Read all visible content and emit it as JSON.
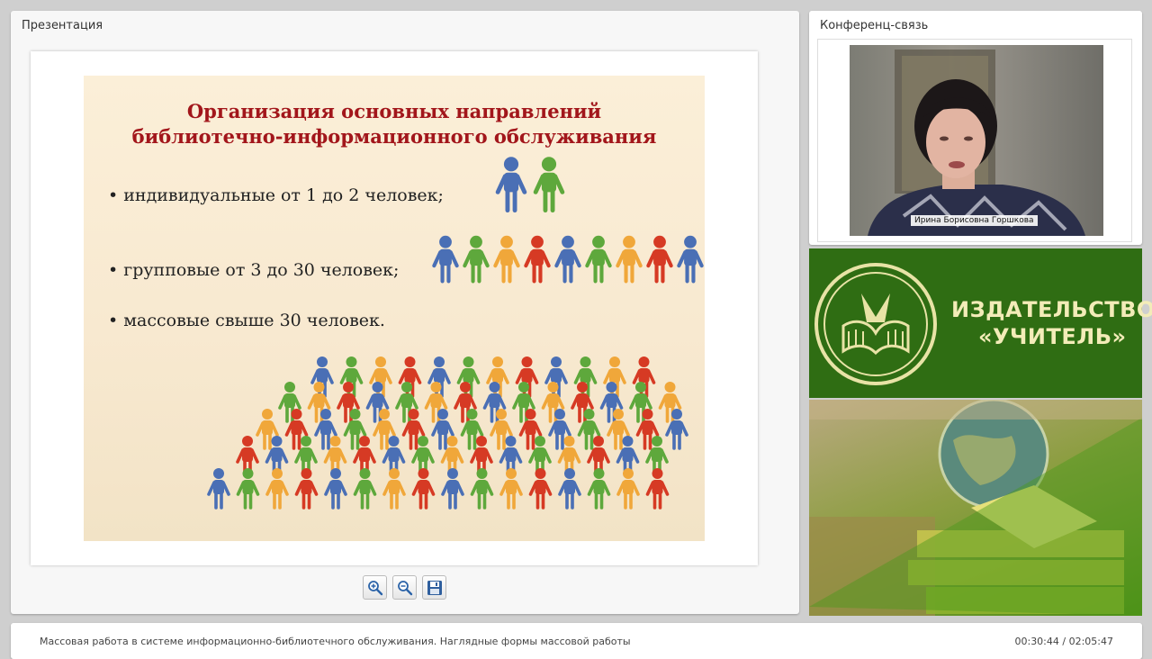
{
  "presentation": {
    "panel_title": "Презентация",
    "slide": {
      "title_line1": "Организация основных направлений",
      "title_line2": "библиотечно-информационного обслуживания",
      "bullets": [
        "•  индивидуальные от 1 до 2 человек;",
        "• групповые от 3 до 30 человек;",
        "• массовые свыше 30 человек."
      ],
      "figure_colors": [
        "#4a6fb5",
        "#5ea83c",
        "#f0a73a",
        "#d63a24"
      ],
      "title_color": "#a2161b"
    },
    "toolbar": [
      {
        "name": "zoom-in",
        "icon": "magnifier-plus-icon"
      },
      {
        "name": "zoom-out",
        "icon": "magnifier-minus-icon"
      },
      {
        "name": "save",
        "icon": "floppy-disk-icon"
      }
    ]
  },
  "conference": {
    "panel_title": "Конференц-связь",
    "speaker_name": "Ирина Борисовна Горшкова"
  },
  "ad": {
    "publisher_line1": "ИЗДАТЕЛЬСТВО",
    "publisher_line2": "«УЧИТЕЛЬ»"
  },
  "footer": {
    "lecture_title": "Массовая работа в системе информационно-библиотечного обслуживания. Наглядные формы массовой работы",
    "time": "00:30:44 / 02:05:47"
  }
}
